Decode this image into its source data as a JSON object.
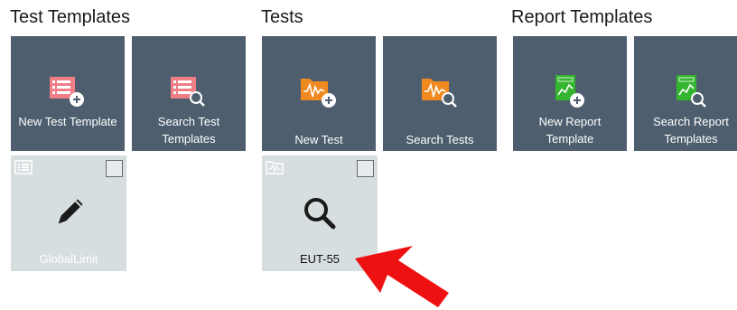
{
  "groups": {
    "test_templates": {
      "title": "Test Templates",
      "new_label": "New Test Template",
      "search_label": "Search Test Templates",
      "items": [
        {
          "name": "GlobalLimit"
        }
      ]
    },
    "tests": {
      "title": "Tests",
      "new_label": "New Test",
      "search_label": "Search Tests",
      "items": [
        {
          "name": "EUT-55"
        }
      ]
    },
    "report_templates": {
      "title": "Report Templates",
      "new_label": "New Report Template",
      "search_label": "Search Report Templates"
    }
  },
  "icons": {
    "test_template": "list-document-icon",
    "test": "waveform-folder-icon",
    "report_template": "report-chart-icon",
    "add": "plus-circle-icon",
    "search": "magnifier-icon",
    "edit": "pencil-icon",
    "annotation": "red-arrow-annotation"
  },
  "colors": {
    "tile_bg": "#4e5e6e",
    "card_bg": "#d7dee0",
    "test_template_accent": "#ef7e86",
    "test_accent": "#f08a20",
    "report_accent": "#33b52f",
    "arrow": "#ee1111"
  }
}
